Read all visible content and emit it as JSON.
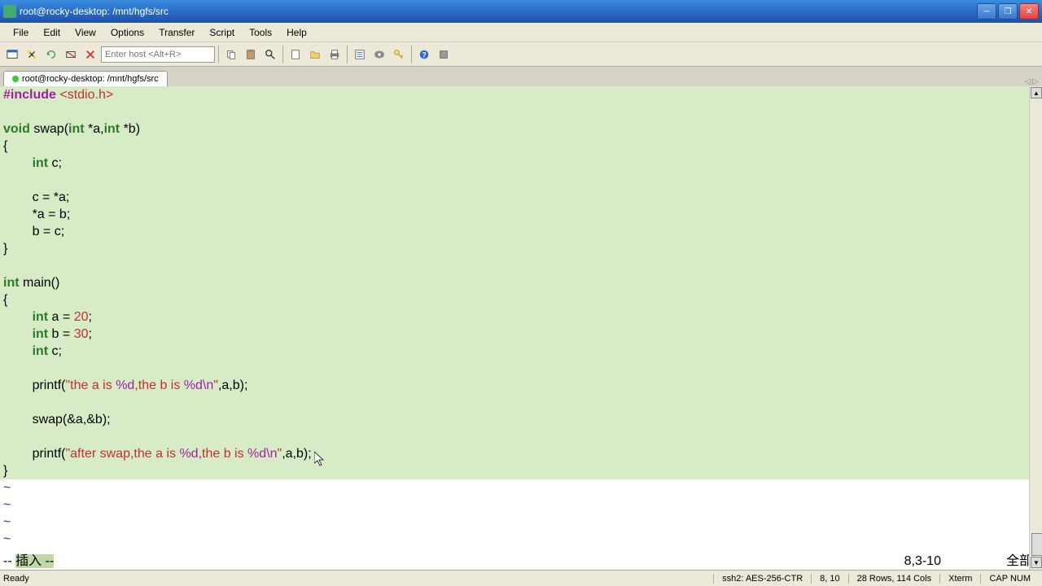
{
  "window": {
    "title": "root@rocky-desktop: /mnt/hgfs/src"
  },
  "menu": {
    "items": [
      "File",
      "Edit",
      "View",
      "Options",
      "Transfer",
      "Script",
      "Tools",
      "Help"
    ]
  },
  "toolbar": {
    "host_placeholder": "Enter host <Alt+R>"
  },
  "tab": {
    "title": "root@rocky-desktop: /mnt/hgfs/src"
  },
  "code": {
    "lines": [
      {
        "t": "inc",
        "include": "#include",
        "lt": "<",
        "hdr": "stdio.h",
        ">": ">"
      },
      {
        "t": "blank"
      },
      {
        "t": "func",
        "ret": "void",
        "name": " swap(",
        "p1t": "int",
        "p1": " *a,",
        "p2t": "int",
        "p2": " *b)"
      },
      {
        "t": "plain",
        "txt": "{"
      },
      {
        "t": "decl",
        "indent": "        ",
        "type": "int",
        "rest": " c;"
      },
      {
        "t": "blank"
      },
      {
        "t": "plain",
        "txt": "        c = *a;"
      },
      {
        "t": "plain",
        "txt": "        *a = b;"
      },
      {
        "t": "plain",
        "txt": "        b = c;"
      },
      {
        "t": "plain",
        "txt": "}"
      },
      {
        "t": "blank"
      },
      {
        "t": "func",
        "ret": "int",
        "name": " main()",
        "p1t": "",
        "p1": "",
        "p2t": "",
        "p2": ""
      },
      {
        "t": "plain",
        "txt": "{"
      },
      {
        "t": "decl2",
        "indent": "        ",
        "type": "int",
        "mid": " a = ",
        "num": "20",
        "end": ";"
      },
      {
        "t": "decl2",
        "indent": "        ",
        "type": "int",
        "mid": " b = ",
        "num": "30",
        "end": ";"
      },
      {
        "t": "decl",
        "indent": "        ",
        "type": "int",
        "rest": " c;"
      },
      {
        "t": "blank"
      },
      {
        "t": "printf",
        "indent": "        ",
        "call": "printf(",
        "q1": "\"the a is ",
        "f1": "%d",
        "m": ",the b is ",
        "f2": "%d",
        "e": "\\n",
        "q2": "\"",
        "args": ",a,b);"
      },
      {
        "t": "blank"
      },
      {
        "t": "plain",
        "txt": "        swap(&a,&b);"
      },
      {
        "t": "blank"
      },
      {
        "t": "printf",
        "indent": "        ",
        "call": "printf(",
        "q1": "\"after swap,the a is ",
        "f1": "%d",
        "m": ",the b is ",
        "f2": "%d",
        "e": "\\n",
        "q2": "\"",
        "args": ",a,b);"
      },
      {
        "t": "plain",
        "txt": "}"
      }
    ],
    "tilde": "~"
  },
  "vim": {
    "mode_prefix": "-- ",
    "mode_text": "插入 --",
    "position": "8,3-10",
    "scroll": "全部"
  },
  "status": {
    "ready": "Ready",
    "ssh": "ssh2: AES-256-CTR",
    "pos": "8,  10",
    "size": "28 Rows, 114 Cols",
    "term": "Xterm",
    "caps": "CAP  NUM"
  }
}
